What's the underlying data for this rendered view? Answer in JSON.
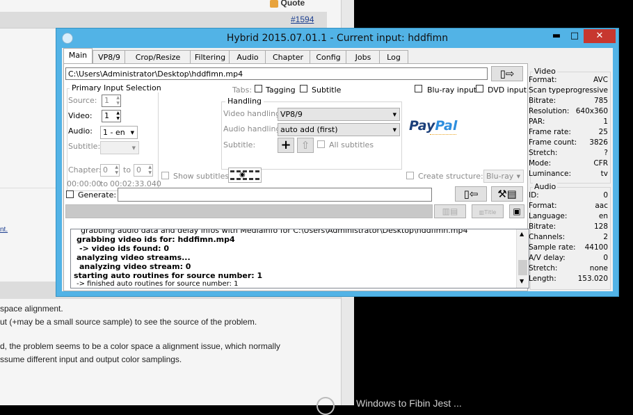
{
  "background": {
    "quote_label": "Quote",
    "post_number": "#1594",
    "link_fragment": "nt.",
    "lines": [
      "space alignment.",
      "ut (+may be a small source sample) to see the source of the problem.",
      "d, the problem seems to be a color space a alignment issue, which normally",
      "ssume different input and output color samplings."
    ],
    "bottom_text": "Windows to Fibin Jest ..."
  },
  "window": {
    "title": "Hybrid 2015.07.01.1 - Current input: hddfimn",
    "min": "▬",
    "max": "□",
    "close": "✕"
  },
  "tabs": [
    "Main",
    "VP8/9",
    "Crop/Resize",
    "Filtering",
    "Audio",
    "Chapter",
    "Config",
    "Jobs",
    "Log"
  ],
  "main": {
    "input_path": "C:\\Users\\Administrator\\Desktop\\hddfimn.mp4",
    "primary_group": "Primary Input Selection",
    "source_label": "Source:",
    "source_value": "1",
    "video_label": "Video:",
    "video_value": "1",
    "audio_label": "Audio:",
    "audio_value": "1 - en",
    "subtitle_label": "Subtitle:",
    "subtitle_value": "",
    "chapter_label": "Chapter:",
    "chapter_from": "0",
    "chapter_to_label": "to",
    "chapter_to": "0",
    "time_from": "00:00:00",
    "time_to_label": "to",
    "time_to": "00:02:33.040",
    "tabs_label": "Tabs:",
    "tagging_label": "Tagging",
    "subtitle_tab_label": "Subtitle",
    "bluray_input": "Blu-ray input",
    "dvd_input": "DVD input",
    "handling_group": "Handling",
    "video_handling_label": "Video handling:",
    "video_handling_value": "VP8/9",
    "audio_handling_label": "Audio handling:",
    "audio_handling_value": "auto add (first)",
    "handling_subtitle_label": "Subtitle:",
    "all_subtitles": "All subtitles",
    "paypal_text": "PayPal",
    "show_subtitles": "Show subtitles",
    "create_structure": "Create structure:",
    "structure_value": "Blu-ray",
    "generate_label": "Generate:",
    "generate_value": "",
    "title_button": "Title"
  },
  "log_lines": [
    "grabbing audio data and delay infos with MediaInfo for C:\\Users\\Administrator\\Desktop\\hddfimn.mp4",
    "grabbing video ids for: hddfimn.mp4",
    "-> video ids found: 0",
    "analyzing video streams...",
    "analyzing video stream: 0",
    "starting auto routines for source number: 1",
    "-> finished auto routines for source number: 1"
  ],
  "video_info": {
    "title": "Video",
    "rows": [
      {
        "k": "Format:",
        "v": "AVC"
      },
      {
        "k": "Scan type:",
        "v": "progressive"
      },
      {
        "k": "Bitrate:",
        "v": "785"
      },
      {
        "k": "Resolution:",
        "v": "640x360"
      },
      {
        "k": "PAR:",
        "v": "1"
      },
      {
        "k": "Frame rate:",
        "v": "25"
      },
      {
        "k": "Frame count:",
        "v": "3826"
      },
      {
        "k": "Stretch:",
        "v": "?"
      },
      {
        "k": "Mode:",
        "v": "CFR"
      },
      {
        "k": "Luminance:",
        "v": "tv"
      }
    ]
  },
  "audio_info": {
    "title": "Audio",
    "rows": [
      {
        "k": "ID:",
        "v": "0"
      },
      {
        "k": "Format:",
        "v": "aac"
      },
      {
        "k": "Language:",
        "v": "en"
      },
      {
        "k": "Bitrate:",
        "v": "128"
      },
      {
        "k": "Channels:",
        "v": "2"
      },
      {
        "k": "Sample rate:",
        "v": "44100"
      },
      {
        "k": "A/V delay:",
        "v": "0"
      },
      {
        "k": "Stretch:",
        "v": "none"
      },
      {
        "k": "Length:",
        "v": "153.020"
      }
    ]
  },
  "colors": {
    "window_frame": "#52b3e6",
    "close_button": "#c7372f",
    "paypal_dark": "#1b3f7a",
    "paypal_light": "#2e8ede",
    "paypal_donate": "#e9a321"
  }
}
